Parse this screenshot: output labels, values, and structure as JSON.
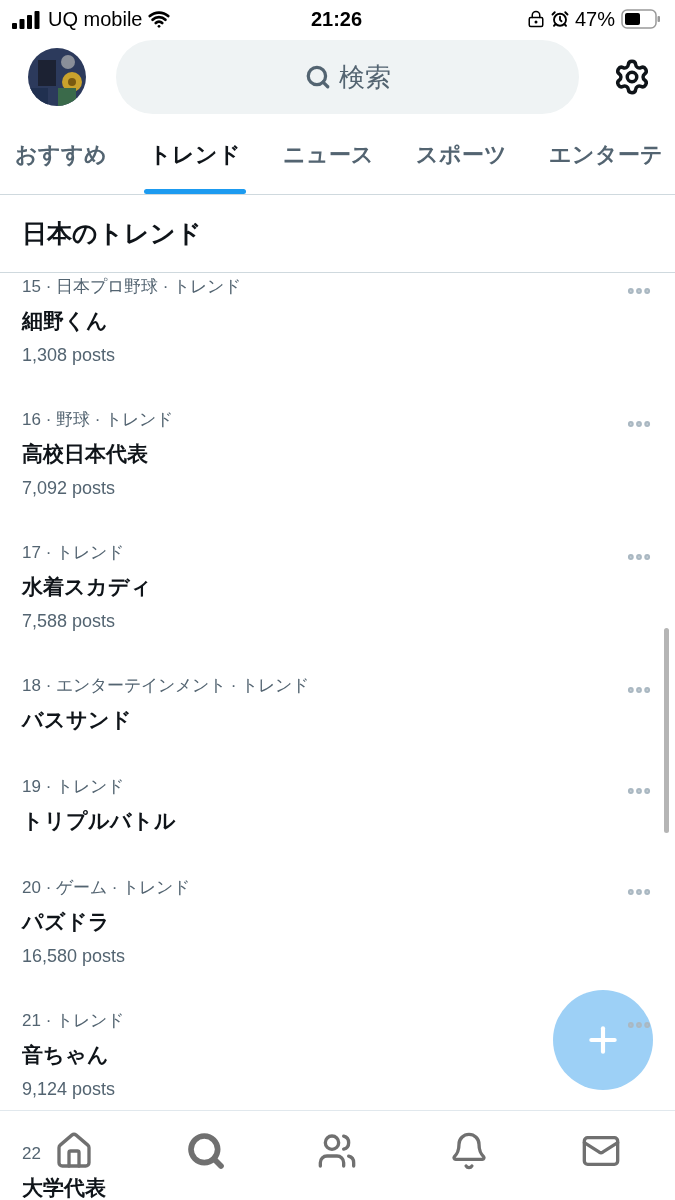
{
  "status_bar": {
    "carrier": "UQ mobile",
    "time": "21:26",
    "battery": "47%"
  },
  "search": {
    "placeholder": "検索"
  },
  "tabs": [
    {
      "label": "おすすめ",
      "selected": false
    },
    {
      "label": "トレンド",
      "selected": true
    },
    {
      "label": "ニュース",
      "selected": false
    },
    {
      "label": "スポーツ",
      "selected": false
    },
    {
      "label": "エンターテ",
      "selected": false
    }
  ],
  "section_title": "日本のトレンド",
  "trends": [
    {
      "meta": "15 · 日本プロ野球 · トレンド",
      "name": "細野くん",
      "posts": "1,308 posts"
    },
    {
      "meta": "16 · 野球 · トレンド",
      "name": "高校日本代表",
      "posts": "7,092 posts"
    },
    {
      "meta": "17 · トレンド",
      "name": "水着スカディ",
      "posts": "7,588 posts"
    },
    {
      "meta": "18 · エンターテインメント · トレンド",
      "name": "バスサンド"
    },
    {
      "meta": "19 · トレンド",
      "name": "トリプルバトル"
    },
    {
      "meta": "20 · ゲーム · トレンド",
      "name": "パズドラ",
      "posts": "16,580 posts"
    },
    {
      "meta": "21 · トレンド",
      "name": "音ちゃん",
      "posts": "9,124 posts"
    },
    {
      "meta": "22",
      "name": "大学代表"
    }
  ],
  "bottom_nav": [
    {
      "kind": "home",
      "selected": false
    },
    {
      "kind": "search",
      "selected": true
    },
    {
      "kind": "communities",
      "selected": false
    },
    {
      "kind": "notifications",
      "selected": false
    },
    {
      "kind": "messages",
      "selected": false
    }
  ]
}
